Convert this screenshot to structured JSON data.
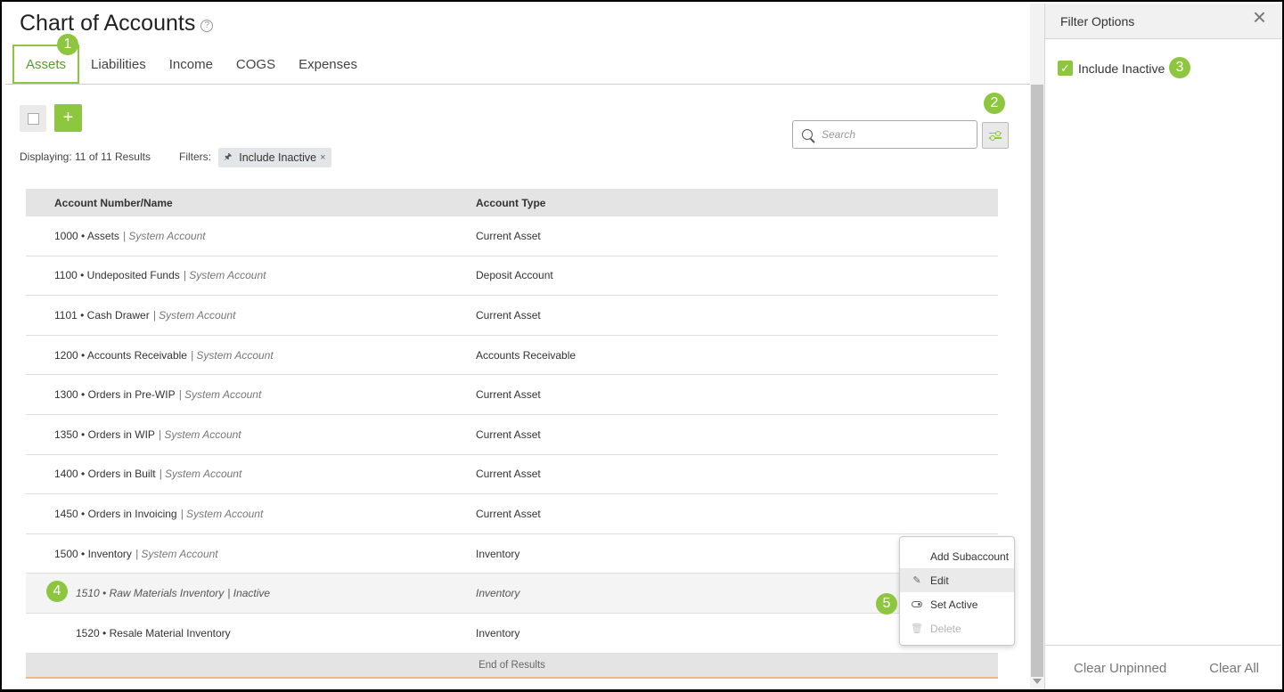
{
  "page": {
    "title": "Chart of Accounts",
    "help_icon": "?"
  },
  "tabs": [
    {
      "label": "Assets",
      "active": true
    },
    {
      "label": "Liabilities"
    },
    {
      "label": "Income"
    },
    {
      "label": "COGS"
    },
    {
      "label": "Expenses"
    }
  ],
  "toolbar": {
    "add_label": "+",
    "displaying": "Displaying: 11 of 11 Results",
    "filters_label": "Filters:",
    "filter_chip": "Include Inactive",
    "filter_chip_close": "×",
    "search_placeholder": "Search"
  },
  "table": {
    "headers": {
      "name": "Account Number/Name",
      "type": "Account Type"
    },
    "rows": [
      {
        "name": "1000 • Assets",
        "meta": "| System Account",
        "type": "Current Asset"
      },
      {
        "name": "1100 • Undeposited Funds",
        "meta": "| System Account",
        "type": "Deposit Account"
      },
      {
        "name": "1101 • Cash Drawer",
        "meta": "| System Account",
        "type": "Current Asset"
      },
      {
        "name": "1200 • Accounts Receivable",
        "meta": "| System Account",
        "type": "Accounts Receivable"
      },
      {
        "name": "1300 • Orders in Pre-WIP",
        "meta": "| System Account",
        "type": "Current Asset"
      },
      {
        "name": "1350 • Orders in WIP",
        "meta": "| System Account",
        "type": "Current Asset"
      },
      {
        "name": "1400 • Orders in Built",
        "meta": "| System Account",
        "type": "Current Asset"
      },
      {
        "name": "1450 • Orders in Invoicing",
        "meta": "| System Account",
        "type": "Current Asset"
      },
      {
        "name": "1500 • Inventory",
        "meta": "| System Account",
        "type": "Inventory"
      },
      {
        "name": "1510 • Raw Materials Inventory",
        "meta": "| Inactive",
        "type": "Inventory"
      },
      {
        "name": "1520 • Resale Material Inventory",
        "meta": "",
        "type": "Inventory"
      }
    ],
    "end_text": "End of Results"
  },
  "context_menu": {
    "items": [
      {
        "label": "Add Subaccount",
        "icon": ""
      },
      {
        "label": "Edit",
        "icon": "pencil-icon"
      },
      {
        "label": "Set Active",
        "icon": "toggle-icon"
      },
      {
        "label": "Delete",
        "icon": "trash-icon"
      }
    ]
  },
  "filter_panel": {
    "title": "Filter Options",
    "include_inactive_label": "Include Inactive",
    "include_inactive_checked": true,
    "clear_unpinned": "Clear Unpinned",
    "clear_all": "Clear All"
  },
  "badges": [
    "1",
    "2",
    "3",
    "4",
    "5"
  ],
  "colors": {
    "accent": "#8dc63f",
    "header_bg": "#e4e4e4"
  }
}
